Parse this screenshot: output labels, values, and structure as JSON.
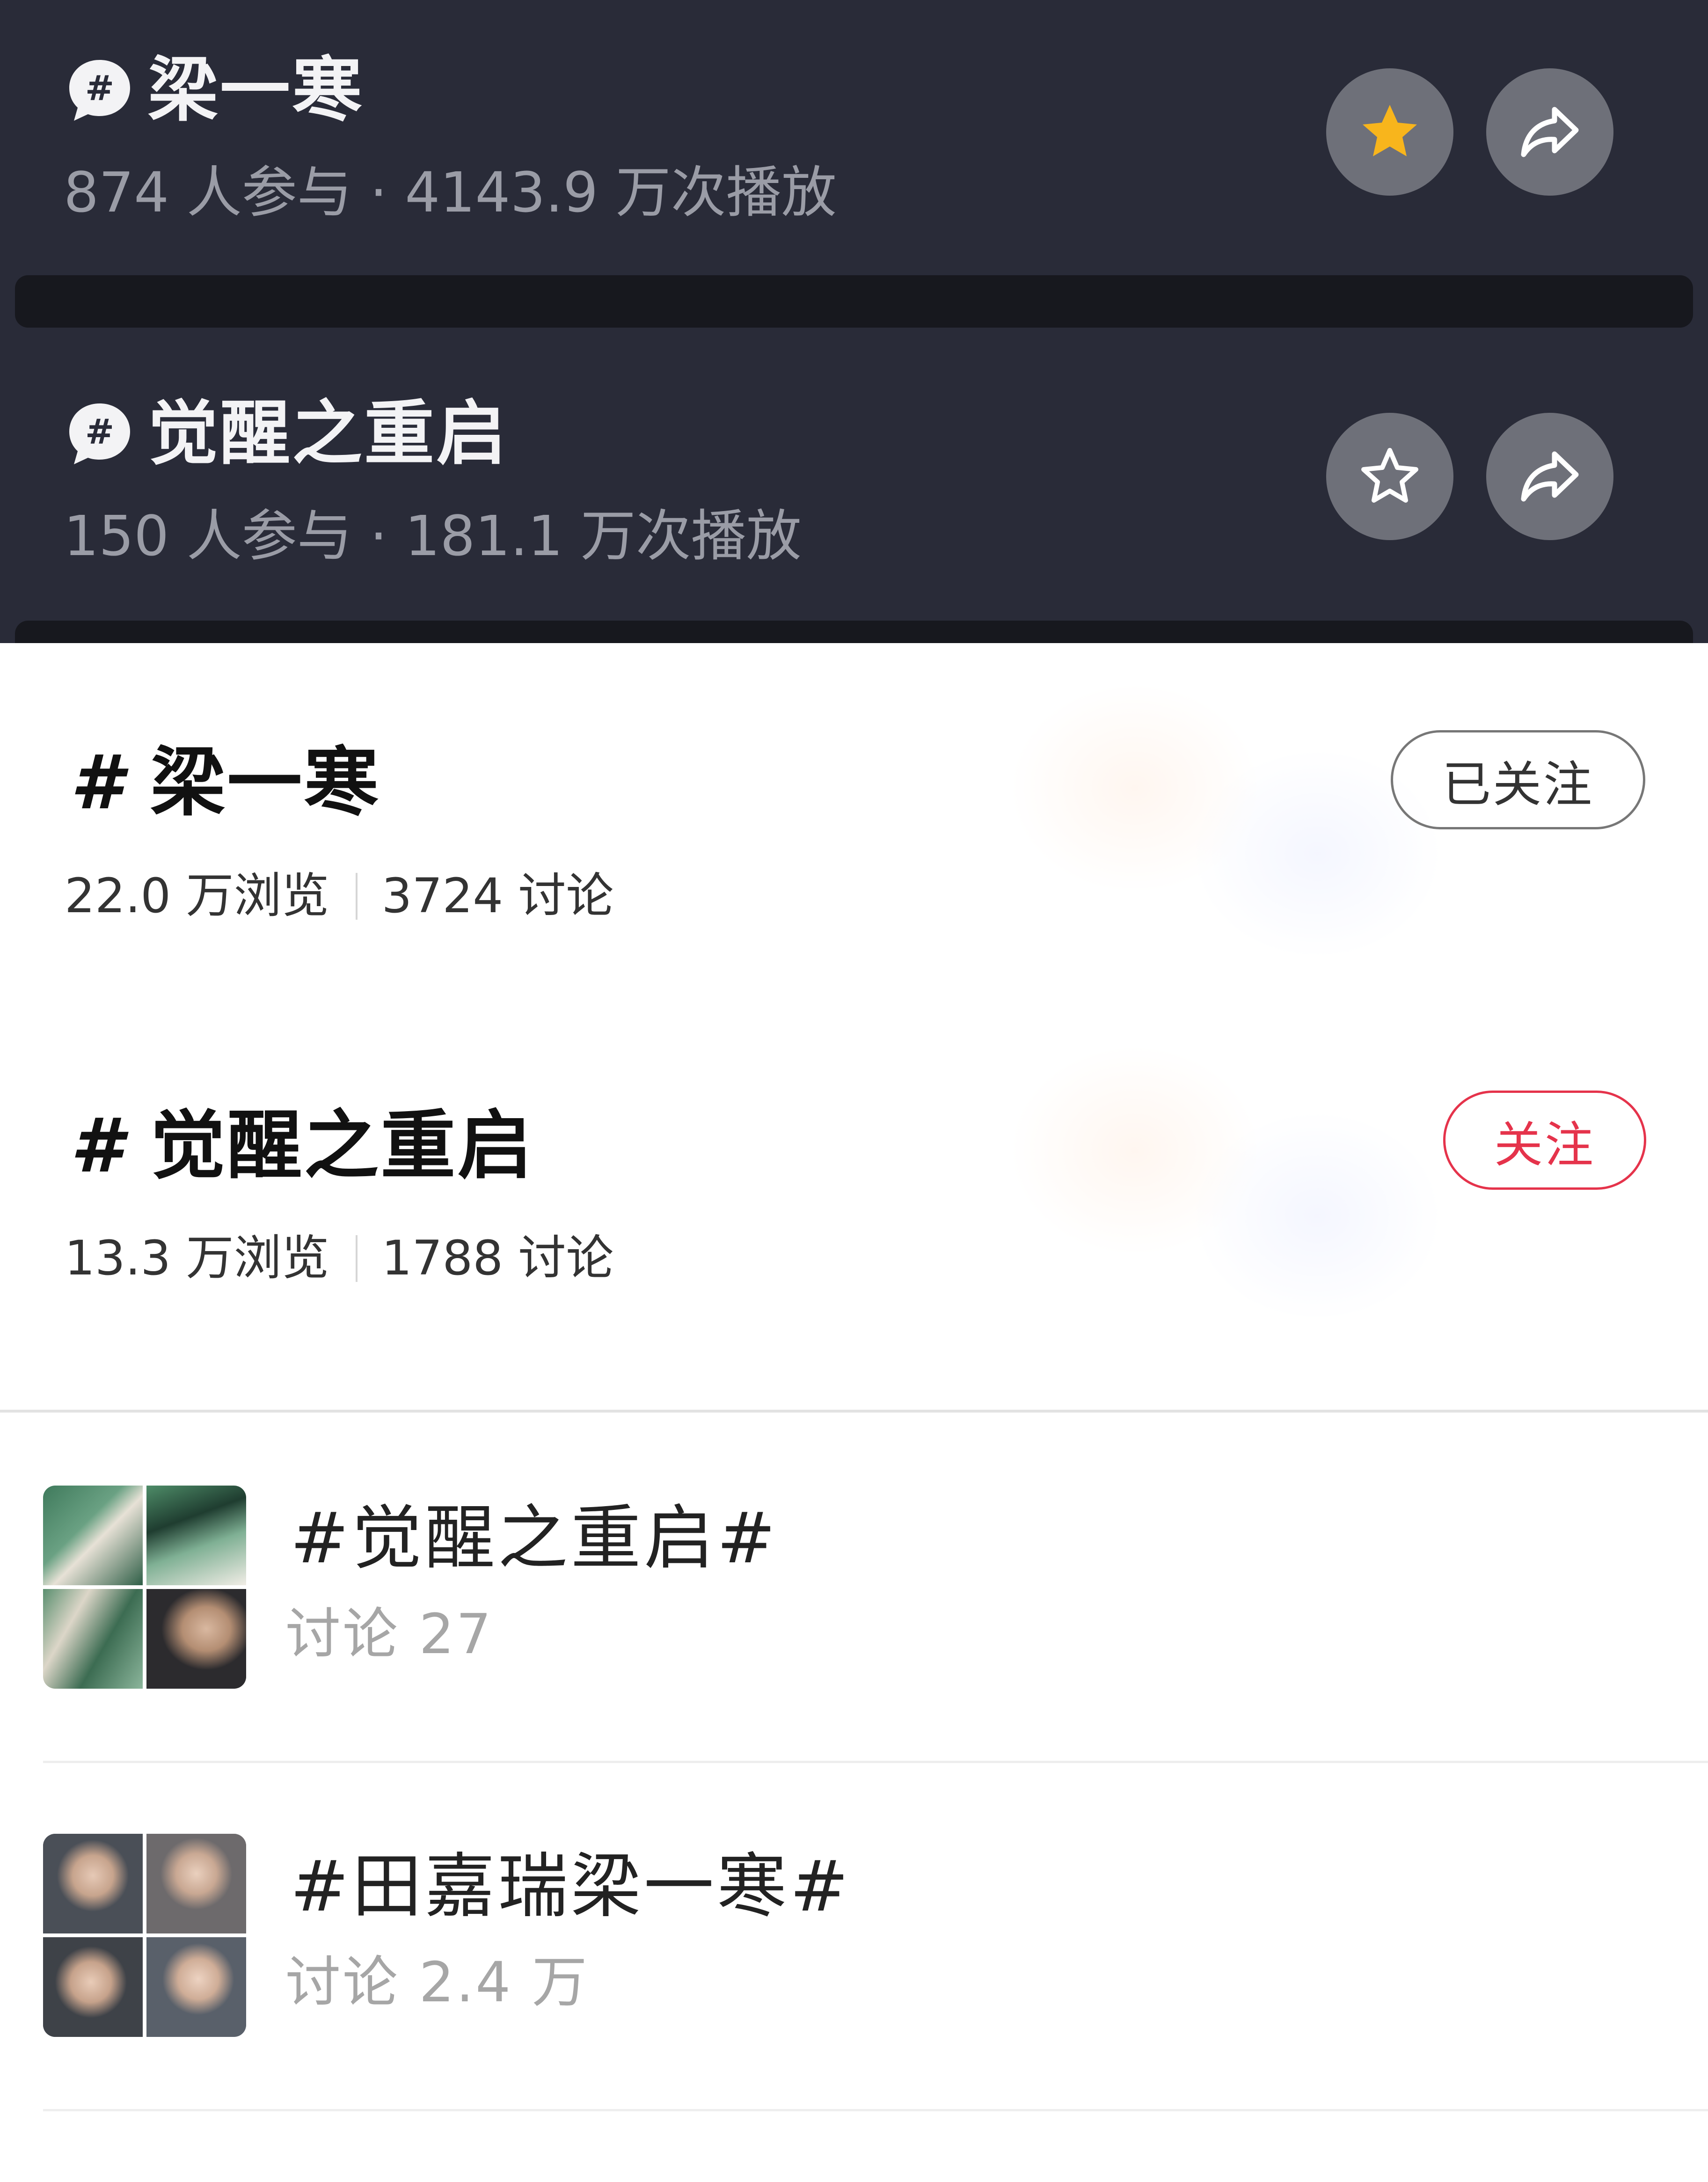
{
  "dark_topics": [
    {
      "title": "梁一寒",
      "stats": "874 人参与 · 4143.9 万次播放",
      "favorited": true,
      "favorite_icon": "star-filled-icon",
      "share_icon": "share-arrow-icon"
    },
    {
      "title": "觉醒之重启",
      "stats": "150 人参与 · 181.1 万次播放",
      "favorited": false,
      "favorite_icon": "star-outline-icon",
      "share_icon": "share-arrow-icon"
    }
  ],
  "topic_cards": [
    {
      "hash": "#",
      "title": "梁一寒",
      "views": "22.0 万浏览",
      "discussions": "3724 讨论",
      "follow_label": "已关注",
      "following": true
    },
    {
      "hash": "#",
      "title": "觉醒之重启",
      "views": "13.3 万浏览",
      "discussions": "1788 讨论",
      "follow_label": "关注",
      "following": false
    }
  ],
  "topic_list": [
    {
      "title": "#觉醒之重启#",
      "meta": "讨论 27",
      "thumb_palette": [
        "#3f7a5c",
        "#4e8c68",
        "#5a8f6f",
        "#2c2b2e"
      ]
    },
    {
      "title": "#田嘉瑞梁一寒#",
      "meta": "讨论 2.4 万",
      "thumb_palette": [
        "#4a4f57",
        "#6d6a6c",
        "#3e4248",
        "#59606a"
      ]
    }
  ],
  "colors": {
    "dark_bg": "#292b38",
    "star_gold": "#f8b51c",
    "follow_red": "#e5334b"
  }
}
